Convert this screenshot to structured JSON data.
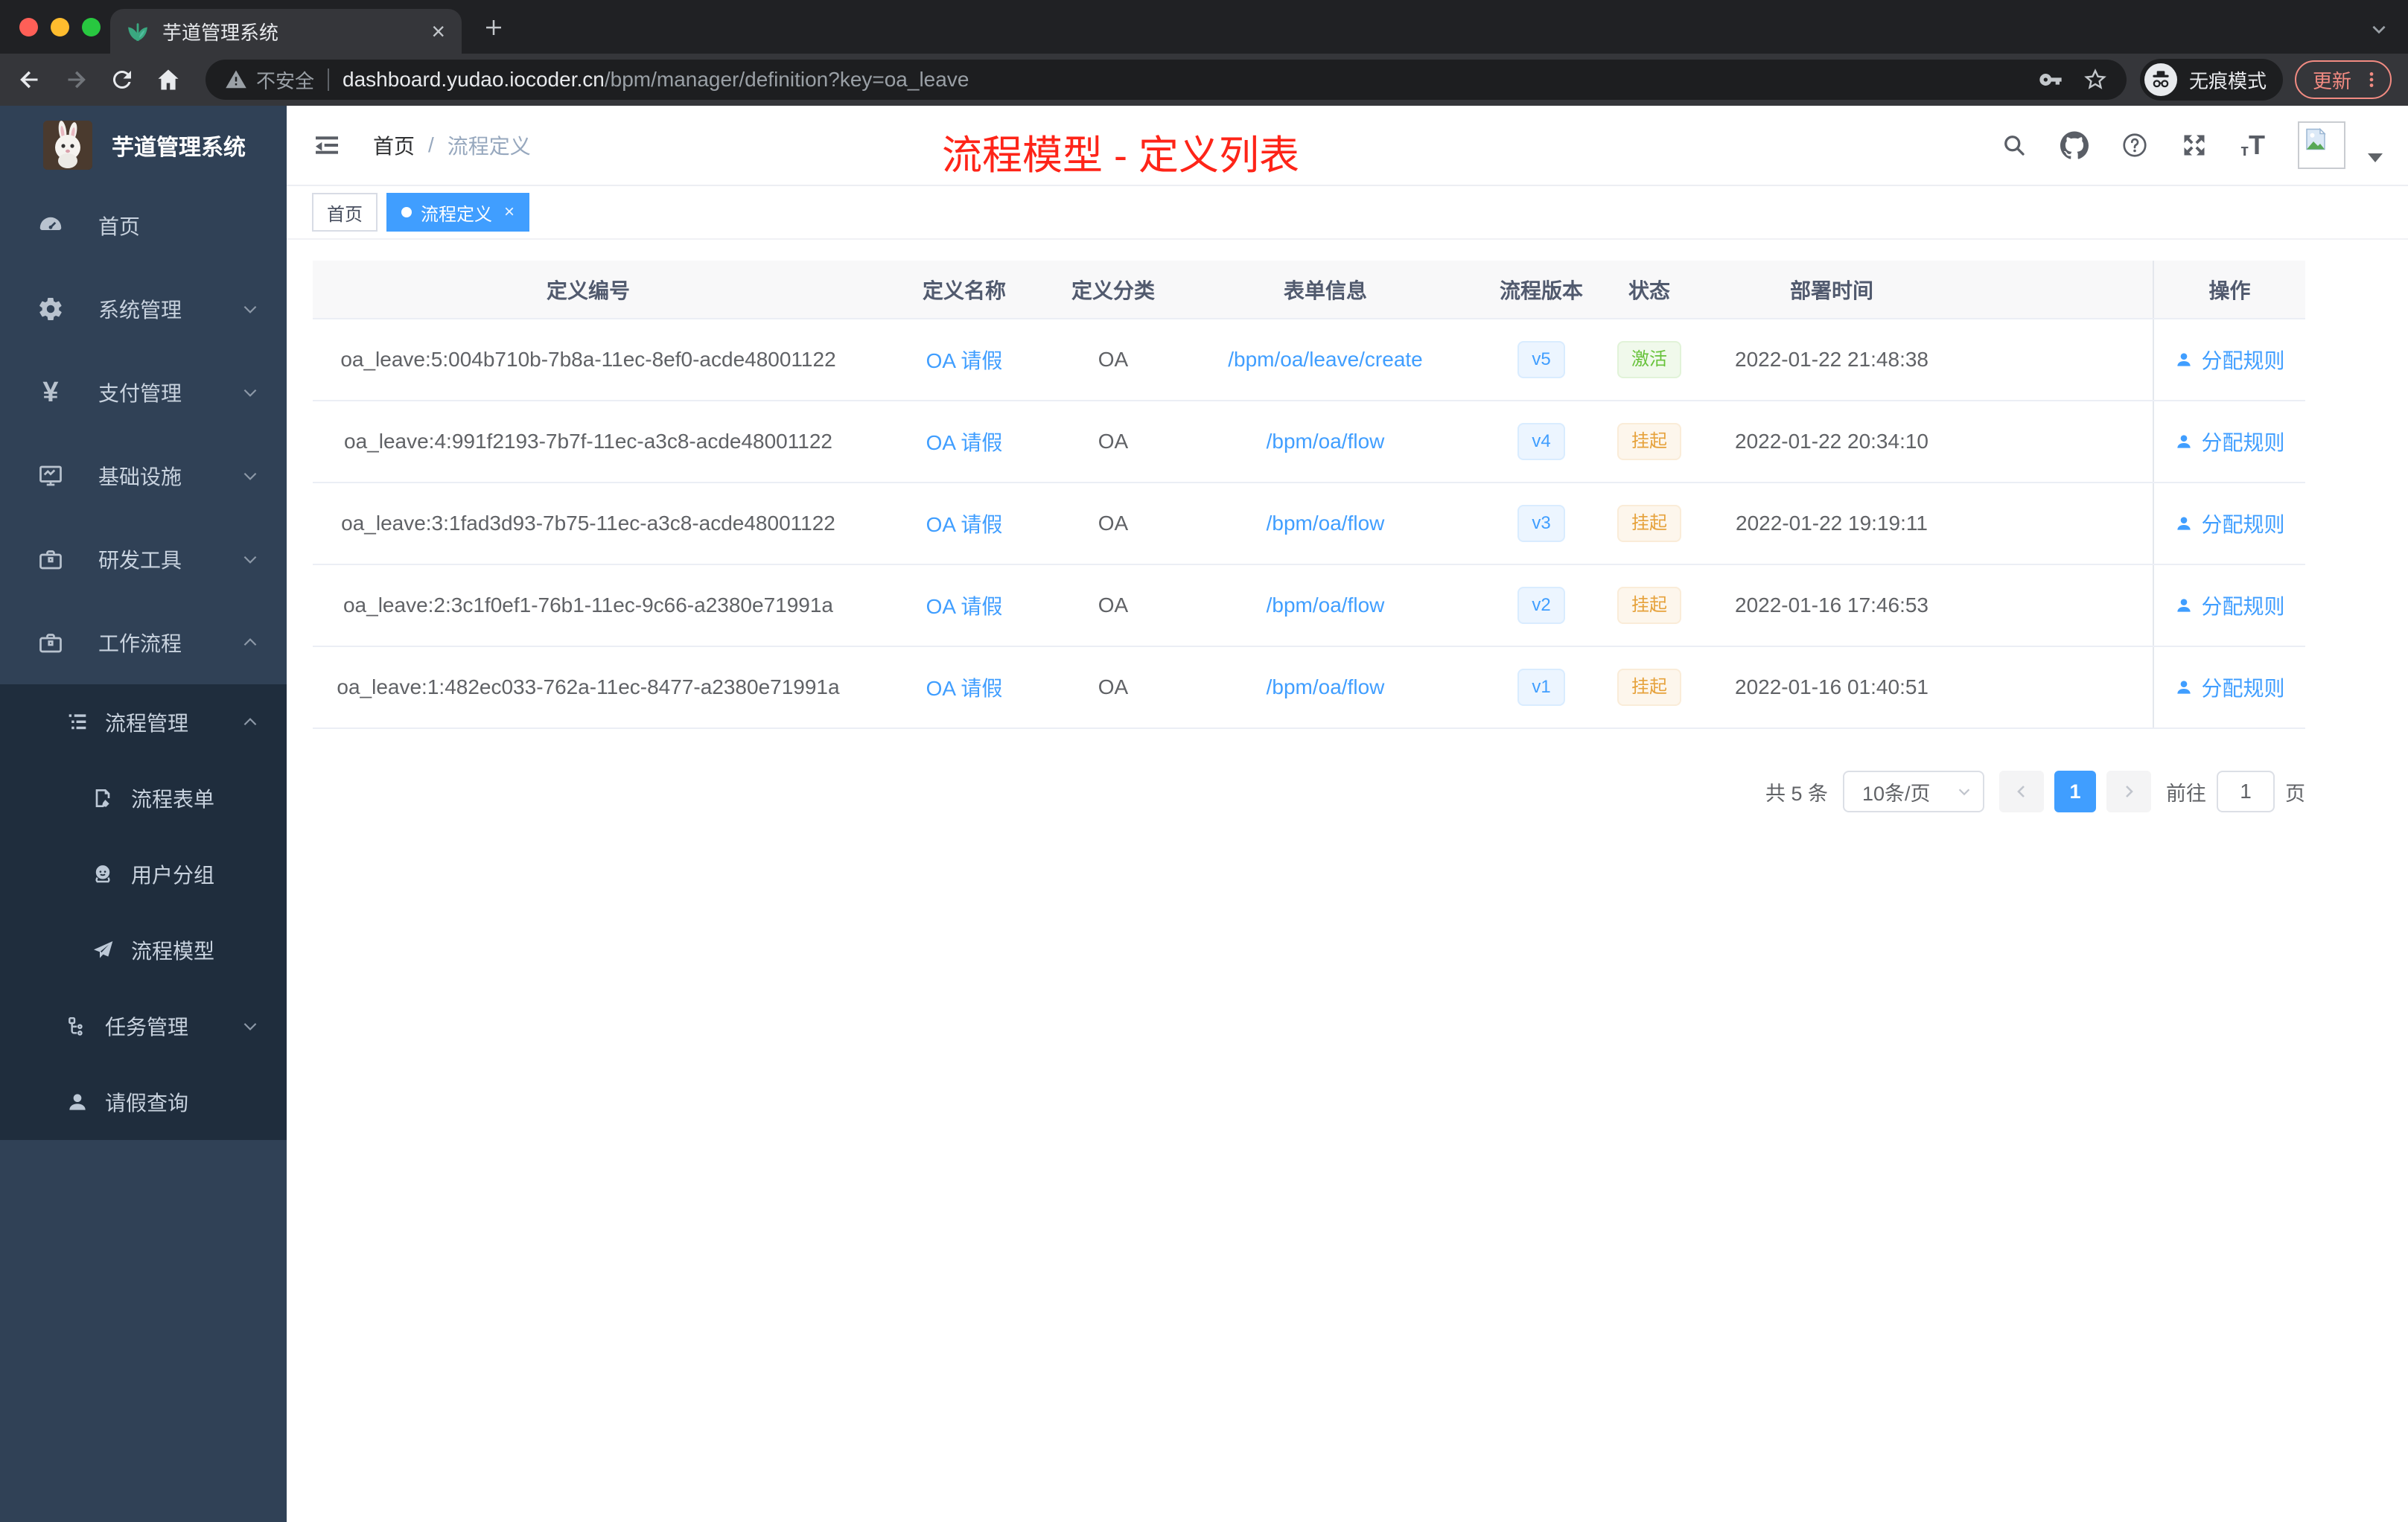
{
  "browser": {
    "tab_title": "芋道管理系统",
    "security_label": "不安全",
    "url_domain": "dashboard.yudao.iocoder.cn",
    "url_path": "/bpm/manager/definition?key=oa_leave",
    "incognito_label": "无痕模式",
    "update_label": "更新"
  },
  "sidebar": {
    "app_title": "芋道管理系统",
    "menu": [
      {
        "label": "首页"
      },
      {
        "label": "系统管理"
      },
      {
        "label": "支付管理"
      },
      {
        "label": "基础设施"
      },
      {
        "label": "研发工具"
      },
      {
        "label": "工作流程"
      }
    ],
    "submenu": [
      {
        "label": "流程管理"
      },
      {
        "label": "流程表单"
      },
      {
        "label": "用户分组"
      },
      {
        "label": "流程模型"
      },
      {
        "label": "任务管理"
      },
      {
        "label": "请假查询"
      }
    ]
  },
  "navbar": {
    "breadcrumb_home": "首页",
    "breadcrumb_sep": "/",
    "breadcrumb_current": "流程定义",
    "annotation": "流程模型 - 定义列表"
  },
  "tags": {
    "home": "首页",
    "active": "流程定义",
    "close": "×"
  },
  "table": {
    "columns": [
      "定义编号",
      "定义名称",
      "定义分类",
      "表单信息",
      "流程版本",
      "状态",
      "部署时间",
      "操作"
    ],
    "rows": [
      {
        "id": "oa_leave:5:004b710b-7b8a-11ec-8ef0-acde48001122",
        "name": "OA 请假",
        "category": "OA",
        "form": "/bpm/oa/leave/create",
        "version": "v5",
        "status": "激活",
        "time": "2022-01-22 21:48:38",
        "action": "分配规则"
      },
      {
        "id": "oa_leave:4:991f2193-7b7f-11ec-a3c8-acde48001122",
        "name": "OA 请假",
        "category": "OA",
        "form": "/bpm/oa/flow",
        "version": "v4",
        "status": "挂起",
        "time": "2022-01-22 20:34:10",
        "action": "分配规则"
      },
      {
        "id": "oa_leave:3:1fad3d93-7b75-11ec-a3c8-acde48001122",
        "name": "OA 请假",
        "category": "OA",
        "form": "/bpm/oa/flow",
        "version": "v3",
        "status": "挂起",
        "time": "2022-01-22 19:19:11",
        "action": "分配规则"
      },
      {
        "id": "oa_leave:2:3c1f0ef1-76b1-11ec-9c66-a2380e71991a",
        "name": "OA 请假",
        "category": "OA",
        "form": "/bpm/oa/flow",
        "version": "v2",
        "status": "挂起",
        "time": "2022-01-16 17:46:53",
        "action": "分配规则"
      },
      {
        "id": "oa_leave:1:482ec033-762a-11ec-8477-a2380e71991a",
        "name": "OA 请假",
        "category": "OA",
        "form": "/bpm/oa/flow",
        "version": "v1",
        "status": "挂起",
        "time": "2022-01-16 01:40:51",
        "action": "分配规则"
      }
    ]
  },
  "pagination": {
    "total": "共 5 条",
    "page_size": "10条/页",
    "current_page": "1",
    "goto_label": "前往",
    "goto_value": "1",
    "page_unit": "页"
  },
  "colors": {
    "accent": "#409eff",
    "annotation": "#fe2418",
    "status_active": "#67c23a",
    "status_suspended": "#e6a23c"
  }
}
